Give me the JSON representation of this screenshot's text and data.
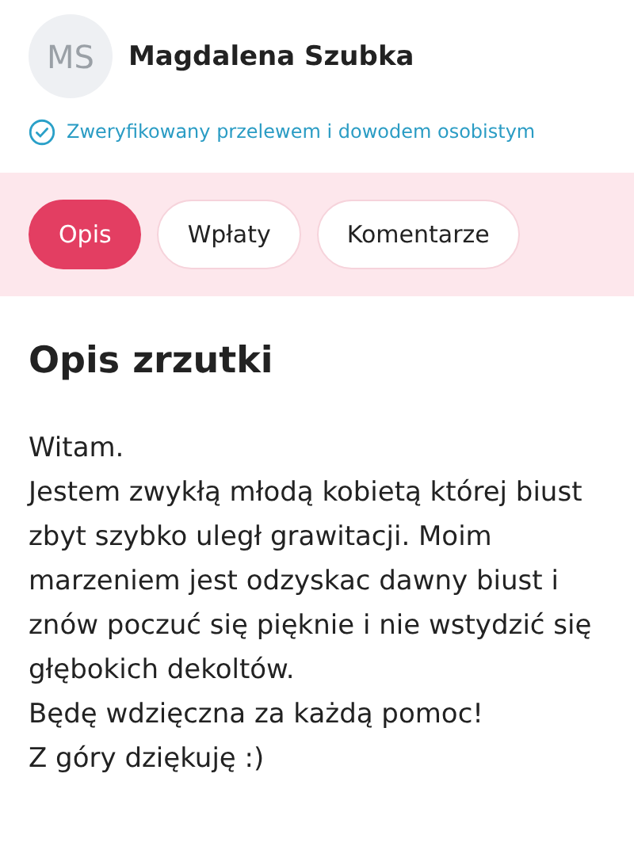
{
  "profile": {
    "initials": "MS",
    "name": "Magdalena Szubka",
    "verification": "Zweryfikowany przelewem i dowodem osobistym"
  },
  "tabs": [
    {
      "label": "Opis",
      "selected": true
    },
    {
      "label": "Wpłaty",
      "selected": false
    },
    {
      "label": "Komentarze",
      "selected": false
    }
  ],
  "section": {
    "title": "Opis zrzutki",
    "paragraphs": [
      "Witam.",
      "Jestem zwykłą młodą kobietą której biust zbyt szybko uległ grawitacji. Moim marzeniem jest odzyskac dawny biust i znów poczuć się pięknie i nie wstydzić się głębokich dekoltów.",
      "Będę wdzięczna za każdą pomoc!",
      "Z góry dziękuję :)"
    ]
  }
}
